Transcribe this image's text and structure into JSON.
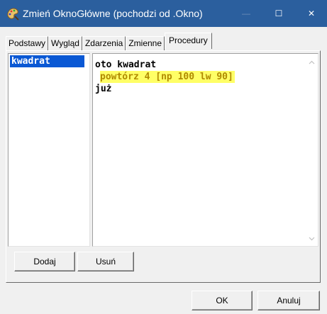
{
  "window": {
    "title": "Zmień OknoGłówne (pochodzi od .Okno)",
    "title_icon": "paint-palette-icon",
    "controls": {
      "minimize": "—",
      "maximize": "☐",
      "close": "✕"
    },
    "titlebar_color": "#2b5f9e"
  },
  "tabs": [
    {
      "label": "Podstawy",
      "active": false
    },
    {
      "label": "Wygląd",
      "active": false
    },
    {
      "label": "Zdarzenia",
      "active": false
    },
    {
      "label": "Zmienne",
      "active": false
    },
    {
      "label": "Procedury",
      "active": true
    }
  ],
  "procedures": {
    "items": [
      "kwadrat"
    ],
    "selected": "kwadrat",
    "selection_color": "#0a58d4"
  },
  "editor": {
    "lines": [
      "oto kwadrat",
      "powtórz 4 [np 100 lw 90]",
      "już"
    ],
    "highlight_color": "#ffff66",
    "highlight_text_color": "#b08a00"
  },
  "buttons": {
    "add": "Dodaj",
    "remove": "Usuń",
    "ok": "OK",
    "cancel": "Anuluj"
  }
}
